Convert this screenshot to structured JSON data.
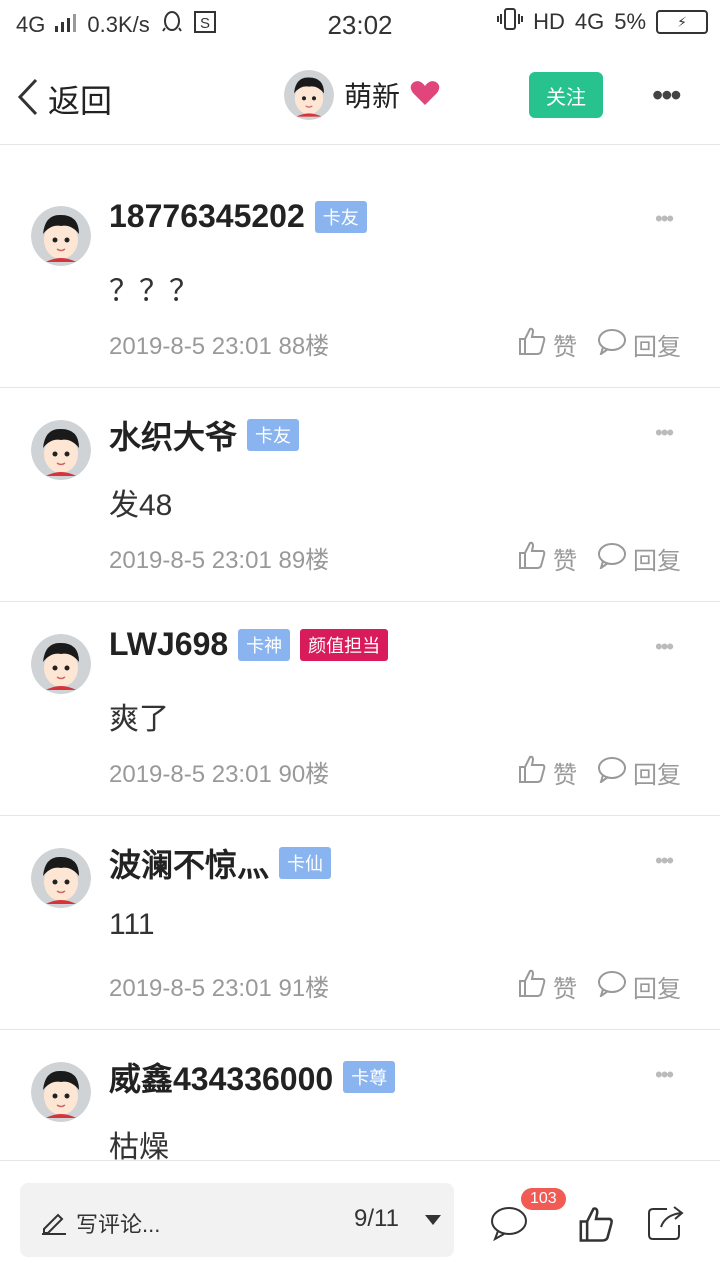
{
  "status_bar": {
    "network": "4G",
    "speed": "0.3K/s",
    "time": "23:02",
    "hd": "HD",
    "network_right": "4G",
    "battery": "5%"
  },
  "nav": {
    "back_label": "返回",
    "title_name": "萌新",
    "follow_label": "关注",
    "more_icon": "more-dots-icon"
  },
  "posts": [
    {
      "username": "18776345202",
      "badges": [
        "卡友"
      ],
      "content": "？？？",
      "time": "2019-8-5 23:01",
      "floor": "88楼"
    },
    {
      "username": "水织大爷",
      "badges": [
        "卡友"
      ],
      "content": "发48",
      "time": "2019-8-5 23:01",
      "floor": "89楼"
    },
    {
      "username": "LWJ698",
      "badges": [
        "卡神",
        "颜值担当"
      ],
      "content": "爽了",
      "time": "2019-8-5 23:01",
      "floor": "90楼"
    },
    {
      "username": "波澜不惊灬",
      "badges": [
        "卡仙"
      ],
      "content": "111",
      "time": "2019-8-5 23:01",
      "floor": "91楼"
    },
    {
      "username": "威鑫434336000",
      "badges": [
        "卡尊"
      ],
      "content": "枯燥",
      "time": "",
      "floor": ""
    }
  ],
  "actions": {
    "like": "赞",
    "reply": "回复"
  },
  "bottom": {
    "comment_placeholder": "写评论...",
    "page_indicator": "9/11",
    "comment_count": "103"
  },
  "colors": {
    "follow_green": "#28c28f",
    "badge_blue": "#8ab4ef",
    "badge_red": "#d81b5b",
    "count_red": "#f25a54"
  }
}
